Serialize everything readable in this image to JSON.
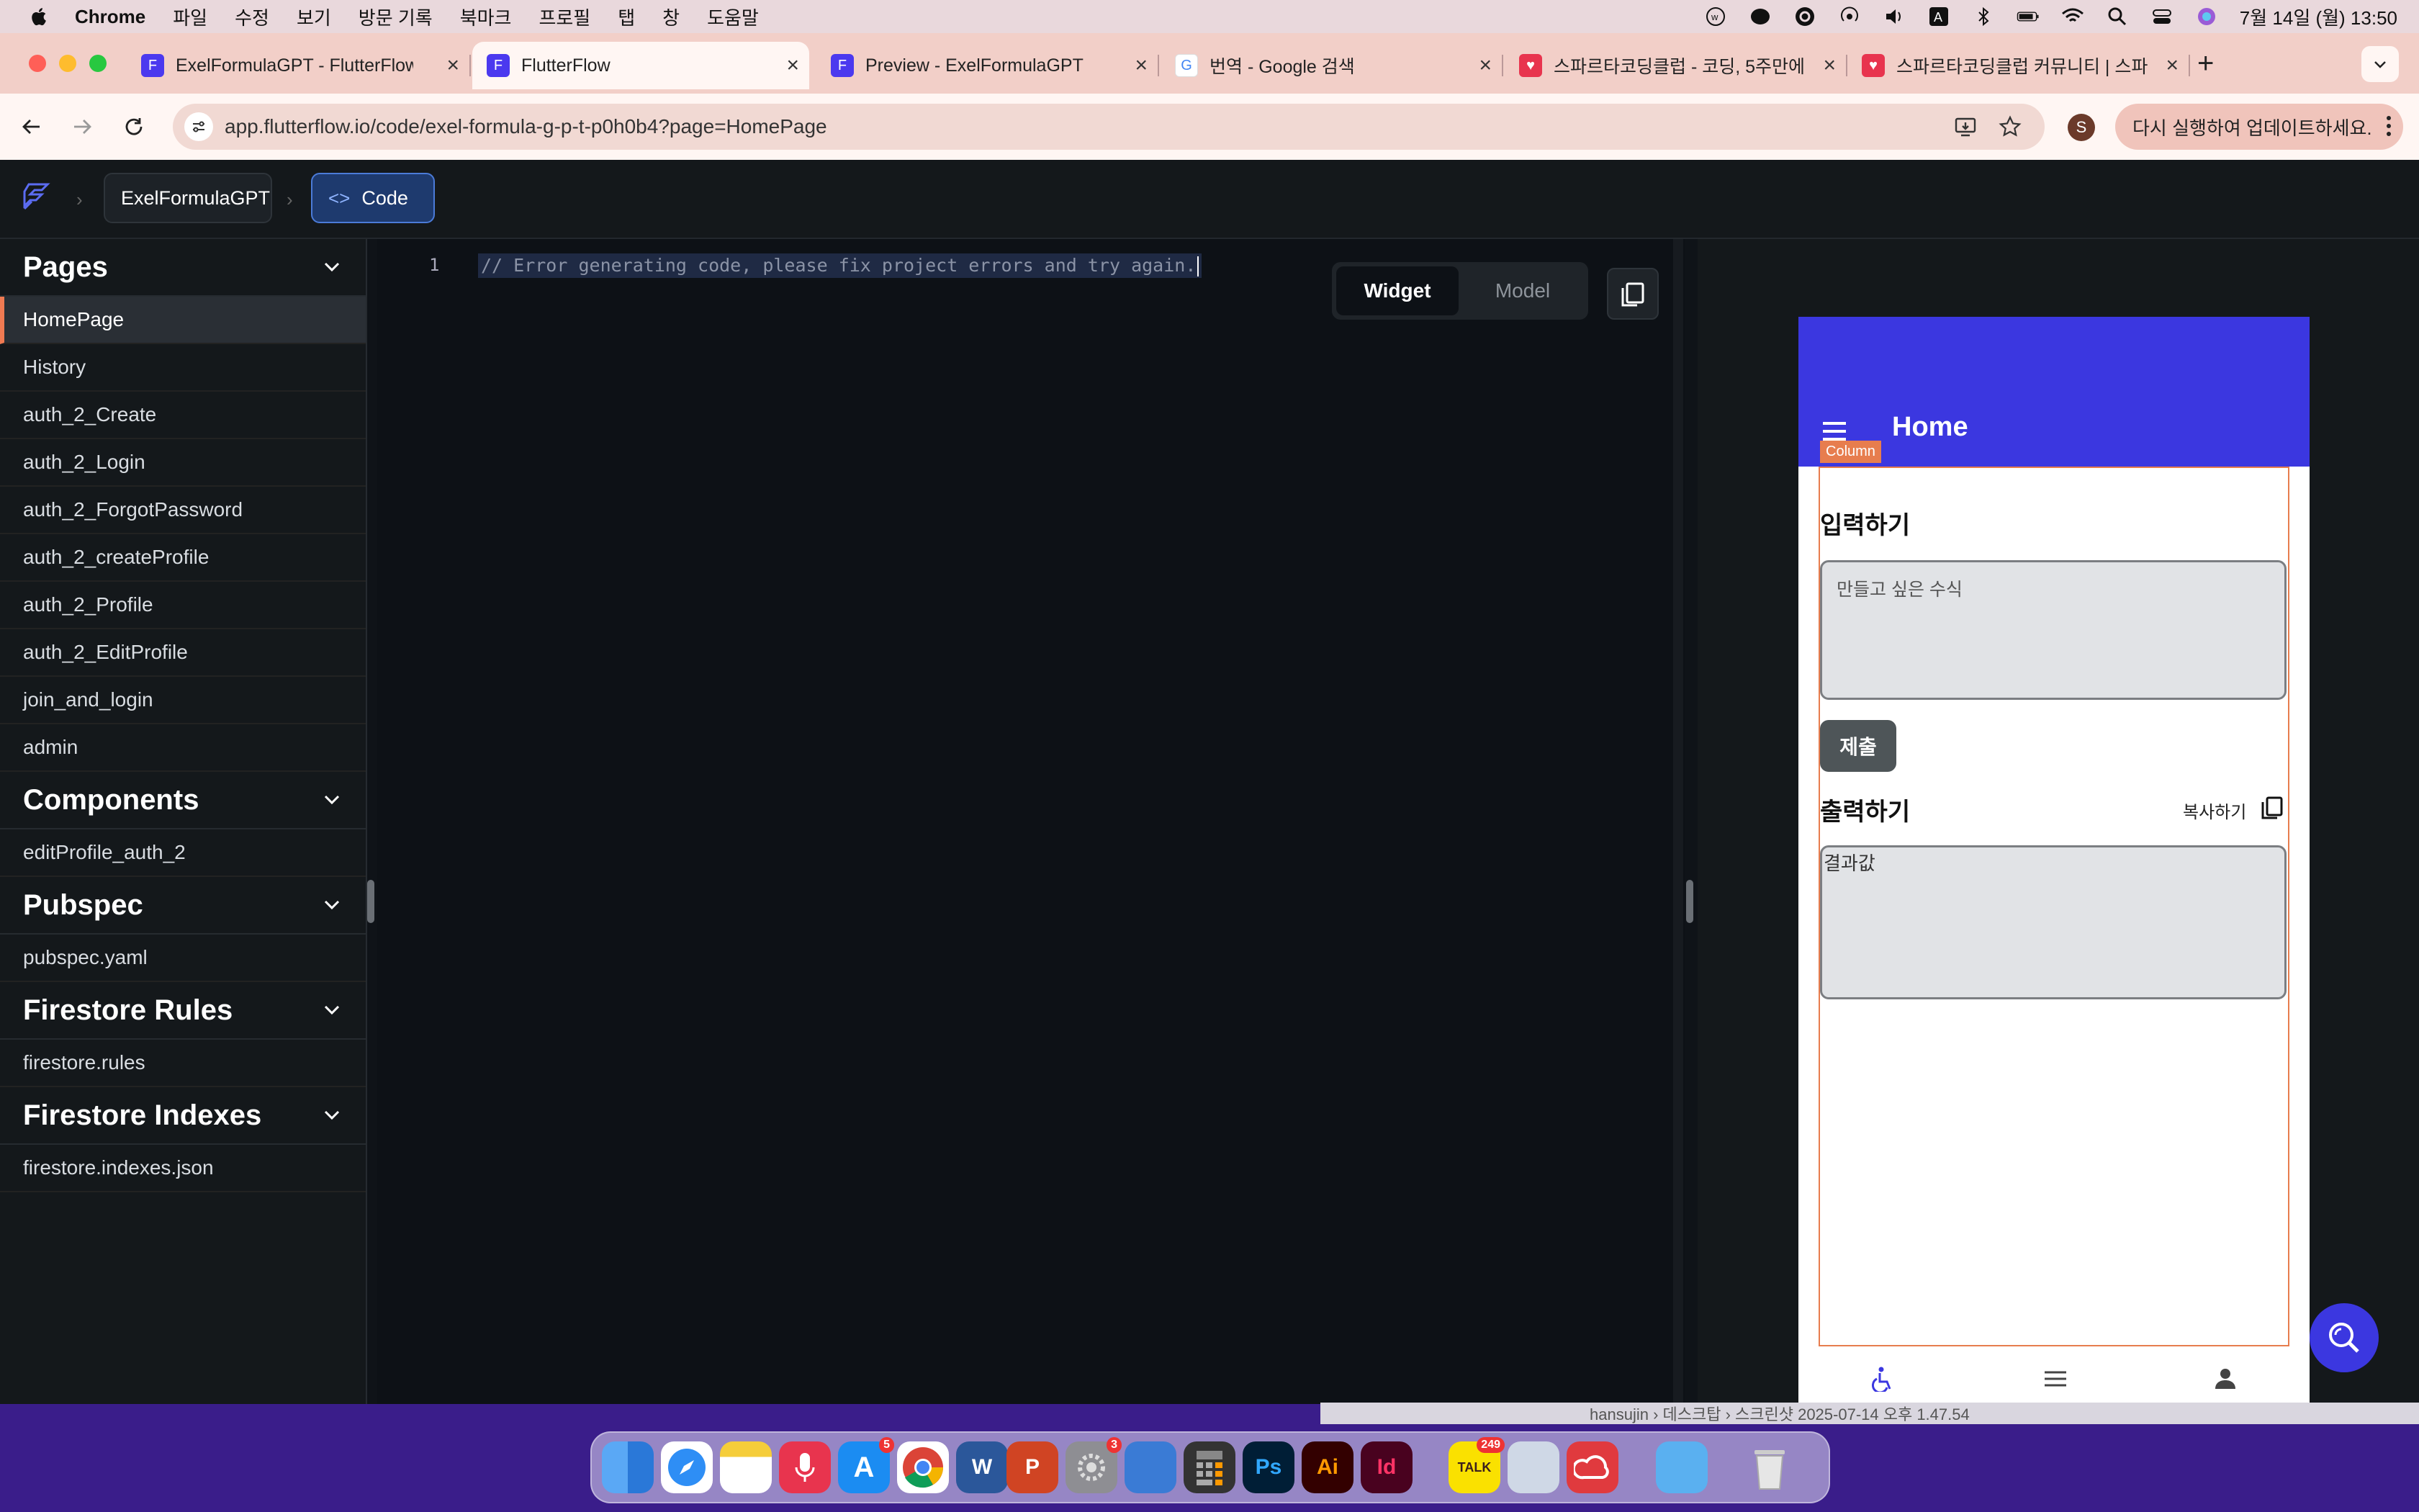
{
  "menubar": {
    "app_name": "Chrome",
    "items": [
      "파일",
      "수정",
      "보기",
      "방문 기록",
      "북마크",
      "프로필",
      "탭",
      "창",
      "도움말"
    ],
    "clock": "7월 14일 (월)  13:50"
  },
  "tabs": [
    {
      "title": "ExelFormulaGPT - FlutterFlow"
    },
    {
      "title": "FlutterFlow"
    },
    {
      "title": "Preview - ExelFormulaGPT"
    },
    {
      "title": "번역 - Google 검색"
    },
    {
      "title": "스파르타코딩클럽 - 코딩, 5주만에"
    },
    {
      "title": "스파르타코딩클럽 커뮤니티 | 스파르"
    }
  ],
  "address": {
    "url": "app.flutterflow.io/code/exel-formula-g-p-t-p0h0b4?page=HomePage",
    "profile_initial": "S",
    "update_label": "다시 실행하여 업데이트하세요."
  },
  "breadcrumb": {
    "project": "ExelFormulaGPT",
    "code": "Code"
  },
  "sidebar": {
    "sections": [
      {
        "title": "Pages",
        "items": [
          "HomePage",
          "History",
          "auth_2_Create",
          "auth_2_Login",
          "auth_2_ForgotPassword",
          "auth_2_createProfile",
          "auth_2_Profile",
          "auth_2_EditProfile",
          "join_and_login",
          "admin"
        ]
      },
      {
        "title": "Components",
        "items": [
          "editProfile_auth_2"
        ]
      },
      {
        "title": "Pubspec",
        "items": [
          "pubspec.yaml"
        ]
      },
      {
        "title": "Firestore Rules",
        "items": [
          "firestore.rules"
        ]
      },
      {
        "title": "Firestore Indexes",
        "items": [
          "firestore.indexes.json"
        ]
      }
    ]
  },
  "code": {
    "line_number": "1",
    "line_text": "// Error generating code, please fix project errors and try again.",
    "toggle_widget": "Widget",
    "toggle_model": "Model"
  },
  "preview": {
    "appbar_title": "Home",
    "column_tag": "Column",
    "input_label": "입력하기",
    "input_placeholder": "만들고 싶은 수식",
    "submit_label": "제출",
    "output_label": "출력하기",
    "copy_label": "복사하기",
    "result_text": "결과값"
  },
  "behind_window": {
    "path": "hansujin  ›  데스크탑  ›  스크린샷 2025-07-14 오후 1.47.54"
  },
  "dock": {
    "appstore_badge": "5",
    "settings_badge": "3",
    "kakaotalk_label": "TALK",
    "kakaotalk_badge": "249",
    "word_label": "W",
    "ps_label": "Ps",
    "ai_label": "Ai",
    "id_label": "Id"
  },
  "colors": {
    "accent": "#3b37e0",
    "active_tab_indicator": "#f07a52",
    "column_outline": "#e77d4e"
  }
}
